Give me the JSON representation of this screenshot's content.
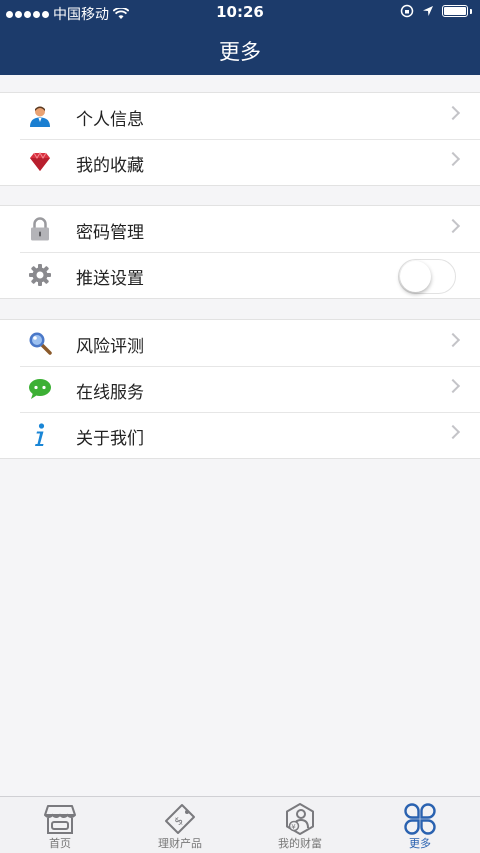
{
  "status_bar": {
    "carrier": "中国移动",
    "time": "10:26"
  },
  "header": {
    "title": "更多"
  },
  "groups": [
    {
      "items": [
        {
          "label": "个人信息",
          "icon": "user-icon",
          "accessory": "chevron"
        },
        {
          "label": "我的收藏",
          "icon": "gem-icon",
          "accessory": "chevron"
        }
      ]
    },
    {
      "items": [
        {
          "label": "密码管理",
          "icon": "lock-icon",
          "accessory": "chevron"
        },
        {
          "label": "推送设置",
          "icon": "gear-icon",
          "accessory": "toggle",
          "toggle_on": false
        }
      ]
    },
    {
      "items": [
        {
          "label": "风险评测",
          "icon": "magnifier-icon",
          "accessory": "chevron"
        },
        {
          "label": "在线服务",
          "icon": "chat-icon",
          "accessory": "chevron"
        },
        {
          "label": "关于我们",
          "icon": "info-icon",
          "accessory": "chevron"
        }
      ]
    }
  ],
  "tabbar": {
    "tabs": [
      {
        "label": "首页",
        "icon": "store-icon"
      },
      {
        "label": "理财产品",
        "icon": "money-tag-icon"
      },
      {
        "label": "我的财富",
        "icon": "wealth-hexagon-icon"
      },
      {
        "label": "更多",
        "icon": "clover-icon",
        "active": true
      }
    ]
  },
  "colors": {
    "header_bg": "#1c3b6b",
    "active_tab": "#2a62b0",
    "background": "#f5f5f7"
  }
}
